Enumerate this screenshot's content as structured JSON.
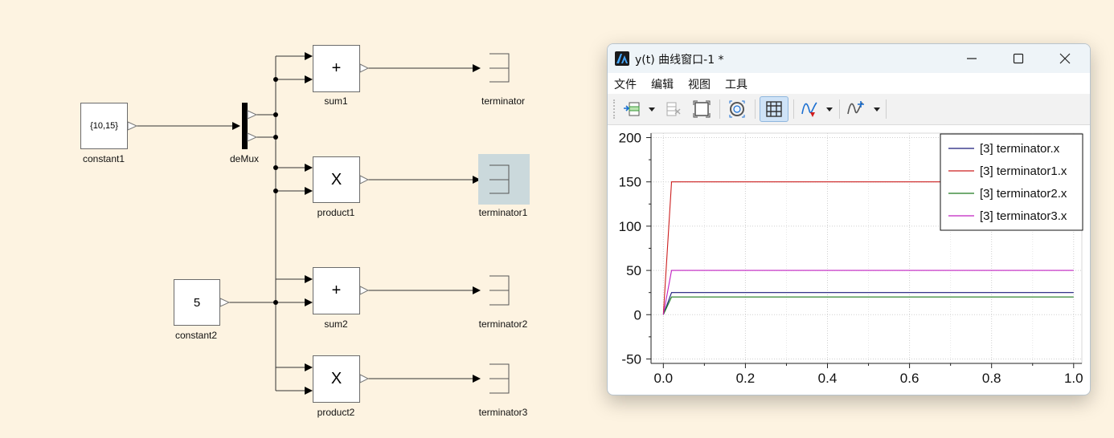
{
  "diagram": {
    "blocks": {
      "constant1": {
        "value": "{10,15}",
        "label": "constant1"
      },
      "demux": {
        "label": "deMux"
      },
      "sum1": {
        "symbol": "+",
        "label": "sum1"
      },
      "product1": {
        "symbol": "X",
        "label": "product1"
      },
      "constant2": {
        "value": "5",
        "label": "constant2"
      },
      "sum2": {
        "symbol": "+",
        "label": "sum2"
      },
      "product2": {
        "symbol": "X",
        "label": "product2"
      },
      "terminator": {
        "label": "terminator"
      },
      "terminator1": {
        "label": "terminator1",
        "selected": true
      },
      "terminator2": {
        "label": "terminator2"
      },
      "terminator3": {
        "label": "terminator3"
      }
    },
    "colors": {
      "background": "#fdf3e1",
      "selection": "#cbd9dc"
    }
  },
  "plot_window": {
    "title": "y(t) 曲线窗口-1 *",
    "app_icon": "app-logo-icon",
    "controls": [
      "minimize-icon",
      "maximize-icon",
      "close-icon"
    ],
    "menus": [
      "文件",
      "编辑",
      "视图",
      "工具"
    ],
    "toolbar_icons": [
      "add-curve-icon",
      "dropdown-arrow-icon",
      "delete-curve-icon",
      "fit-view-icon",
      "zoom-reset-icon",
      "grid-icon",
      "curve-style-icon",
      "dropdown-arrow-icon",
      "add-cursor-icon",
      "dropdown-arrow-icon"
    ],
    "grid_active": true
  },
  "chart_data": {
    "type": "line",
    "title": "",
    "xlabel": "",
    "ylabel": "",
    "xlim": [
      -0.03,
      1.02
    ],
    "ylim": [
      -55,
      205
    ],
    "xticks": [
      0.0,
      0.2,
      0.4,
      0.6,
      0.8,
      1.0
    ],
    "xtick_labels": [
      "0.0",
      "0.2",
      "0.4",
      "0.6",
      "0.8",
      "1.0"
    ],
    "yticks": [
      -50,
      0,
      50,
      100,
      150,
      200
    ],
    "ytick_labels": [
      "-50",
      "0",
      "50",
      "100",
      "150",
      "200"
    ],
    "grid": true,
    "legend_position": "top-right",
    "series": [
      {
        "name": "[3] terminator.x",
        "color": "#1a1a7a",
        "x": [
          0,
          0.02,
          1.0
        ],
        "y": [
          0,
          25,
          25
        ]
      },
      {
        "name": "[3] terminator1.x",
        "color": "#cc1f1f",
        "x": [
          0,
          0.02,
          1.0
        ],
        "y": [
          0,
          150,
          150
        ]
      },
      {
        "name": "[3] terminator2.x",
        "color": "#1e7a1e",
        "x": [
          0,
          0.02,
          1.0
        ],
        "y": [
          0,
          20,
          20
        ]
      },
      {
        "name": "[3] terminator3.x",
        "color": "#c020c0",
        "x": [
          0,
          0.02,
          1.0
        ],
        "y": [
          0,
          50,
          50
        ]
      }
    ]
  }
}
